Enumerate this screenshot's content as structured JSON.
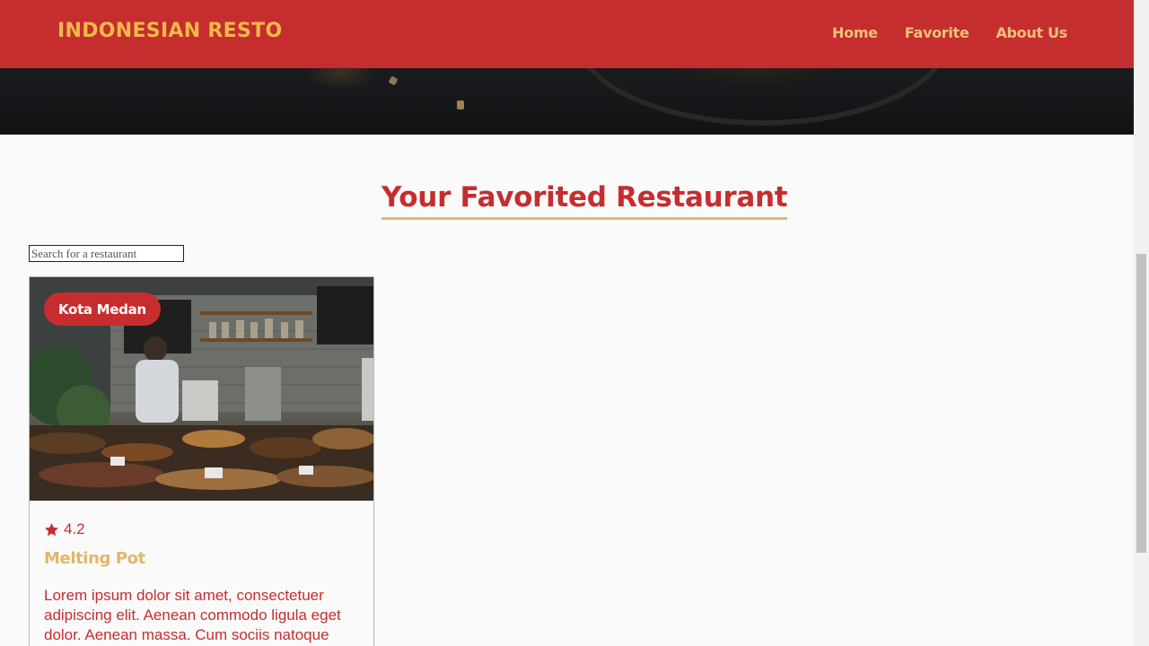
{
  "navbar": {
    "brand": "INDONESIAN RESTO",
    "links": [
      "Home",
      "Favorite",
      "About Us"
    ]
  },
  "main": {
    "title": "Your Favorited Restaurant",
    "search": {
      "placeholder": "Search for a restaurant",
      "value": ""
    }
  },
  "restaurants": [
    {
      "city": "Kota Medan",
      "rating": "4.2",
      "name": "Melting Pot",
      "description": "Lorem ipsum dolor sit amet, consectetuer adipiscing elit. Aenean commodo ligula eget dolor. Aenean massa. Cum sociis natoque"
    }
  ],
  "colors": {
    "primary": "#c62d2f",
    "accent": "#f0b94a",
    "background": "#fafafa"
  },
  "icons": {
    "rating": "star-icon"
  }
}
